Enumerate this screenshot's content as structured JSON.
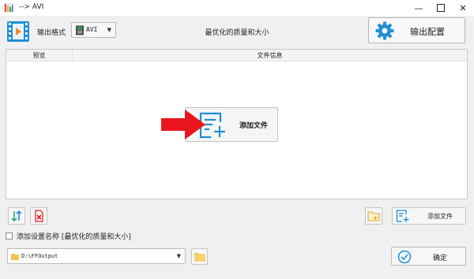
{
  "window": {
    "title": "--> AVI",
    "controls": [
      "minimize",
      "maximize",
      "close"
    ]
  },
  "toolbar": {
    "format_label": "输出格式",
    "format_value": "AVI",
    "quality_text": "最优化的质量和大小",
    "output_config_label": "输出配置"
  },
  "file_list": {
    "columns": [
      "预览",
      "文件信息"
    ],
    "add_file_label": "添加文件"
  },
  "bottom": {
    "add_file_label": "添加文件",
    "settings_checkbox_label": "添加设置名称 [最优化的质量和大小]",
    "output_path": "D:\\FFOutput",
    "confirm_label": "确定"
  },
  "colors": {
    "accent_blue": "#1e8fd5",
    "arrow_red": "#e8161c",
    "folder_yellow": "#f3c64b"
  },
  "icons": [
    "app-icon",
    "film-icon",
    "file-icon",
    "gear-icon",
    "add-file-icon",
    "arrow-right-icon",
    "sort-icon",
    "delete-icon",
    "folder-icon",
    "check-circle-icon"
  ]
}
